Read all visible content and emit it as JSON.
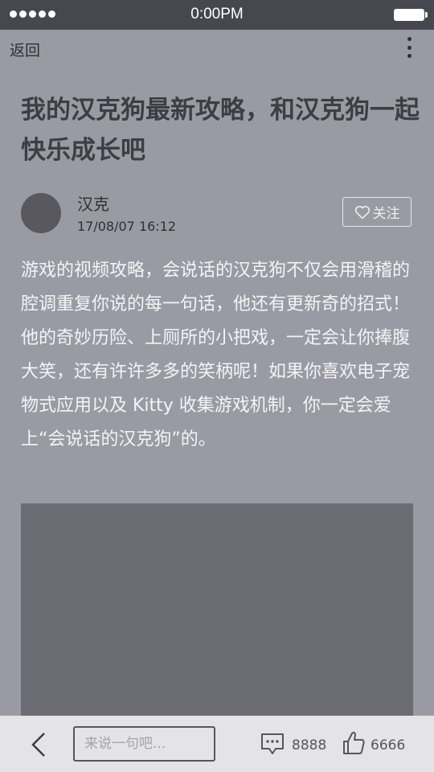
{
  "status_bar": {
    "time": "0:00PM",
    "signal_icon": "signal-dots-icon",
    "battery_icon": "battery-icon"
  },
  "nav": {
    "back_label": "返回",
    "more_icon": "more-vertical-icon"
  },
  "article": {
    "title": "我的汉克狗最新攻略，和汉克狗一起快乐成长吧",
    "author": {
      "name": "汉克",
      "time": "17/08/07  16:12",
      "avatar_icon": "avatar"
    },
    "follow_label": "关注",
    "body": "游戏的视频攻略，会说话的汉克狗不仅会用滑稽的腔调重复你说的每一句话，他还有更新奇的招式！他的奇妙历险、上厕所的小把戏，一定会让你捧腹大笑，还有许许多多的笑柄呢！如果你喜欢电子宠物式应用以及 Kitty 收集游戏机制，你一定会爱上“会说话的汉克狗”的。"
  },
  "bottom_bar": {
    "back_icon": "chevron-left-icon",
    "comment_placeholder": "来说一句吧...",
    "comment_icon": "comment-icon",
    "comment_count": "8888",
    "like_icon": "thumbs-up-icon",
    "like_count": "6666"
  },
  "colors": {
    "status_bar": "#46474f",
    "background": "#9a9aa4",
    "media_placeholder": "#6c6c75",
    "bottom_bar": "#e4e4e7"
  }
}
